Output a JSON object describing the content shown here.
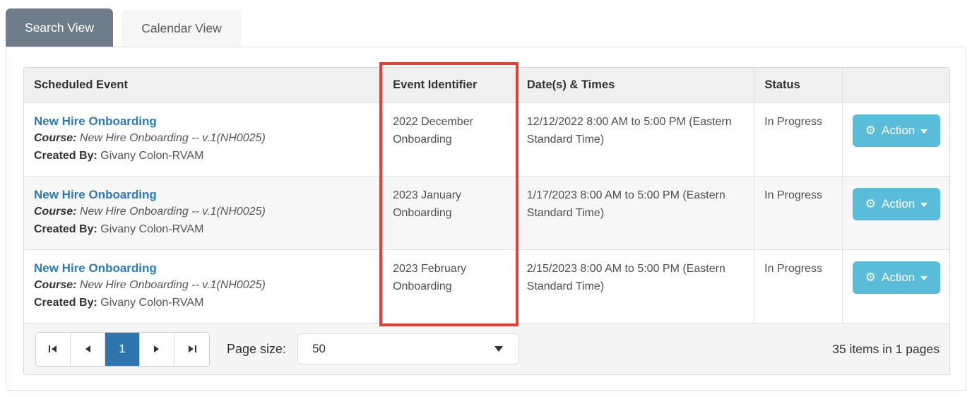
{
  "tabs": {
    "search": "Search View",
    "calendar": "Calendar View"
  },
  "table": {
    "headers": {
      "scheduled_event": "Scheduled Event",
      "event_identifier": "Event Identifier",
      "dates_times": "Date(s) & Times",
      "status": "Status",
      "actions": ""
    },
    "rows": [
      {
        "title": "New Hire Onboarding",
        "course_label": "Course:",
        "course_value": "New Hire Onboarding -- v.1(NH0025)",
        "created_by_label": "Created By:",
        "created_by_value": "Givany Colon-RVAM",
        "event_identifier": "2022 December Onboarding",
        "dates_times": "12/12/2022 8:00 AM to 5:00 PM (Eastern Standard Time)",
        "status": "In Progress",
        "action_label": "Action"
      },
      {
        "title": "New Hire Onboarding",
        "course_label": "Course:",
        "course_value": "New Hire Onboarding -- v.1(NH0025)",
        "created_by_label": "Created By:",
        "created_by_value": "Givany Colon-RVAM",
        "event_identifier": "2023 January Onboarding",
        "dates_times": "1/17/2023 8:00 AM to 5:00 PM (Eastern Standard Time)",
        "status": "In Progress",
        "action_label": "Action"
      },
      {
        "title": "New Hire Onboarding",
        "course_label": "Course:",
        "course_value": "New Hire Onboarding -- v.1(NH0025)",
        "created_by_label": "Created By:",
        "created_by_value": "Givany Colon-RVAM",
        "event_identifier": "2023 February Onboarding",
        "dates_times": "2/15/2023 8:00 AM to 5:00 PM (Eastern Standard Time)",
        "status": "In Progress",
        "action_label": "Action"
      }
    ]
  },
  "pagination": {
    "current_page": "1",
    "page_size_label": "Page size:",
    "page_size_value": "50",
    "items_summary": "35 items in 1 pages"
  },
  "icons": {
    "gear": "⚙"
  },
  "colors": {
    "active_tab_bg": "#6f7d8a",
    "link_blue": "#2e79b9",
    "action_button_bg": "#5bbcd9",
    "active_page_bg": "#2e74ad",
    "highlight_red": "#e2403a",
    "header_bg": "#f0f0f0",
    "pager_bg": "#f5f5f5"
  }
}
